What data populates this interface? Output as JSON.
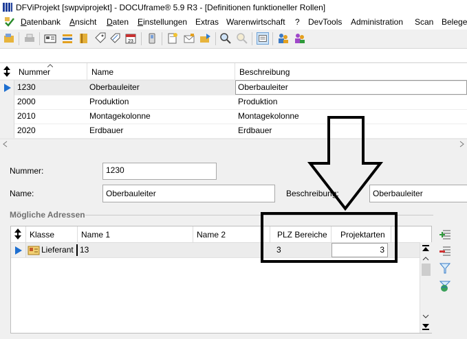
{
  "window": {
    "title": "DFViProjekt [swpviprojekt] - DOCUframe® 5.9 R3 - [Definitionen funktioneller Rollen]"
  },
  "menu": {
    "items": [
      {
        "underline": "D",
        "rest": "atenbank"
      },
      {
        "underline": "A",
        "rest": "nsicht"
      },
      {
        "underline": "D",
        "rest": "aten"
      },
      {
        "underline": "E",
        "rest": "instellungen"
      },
      {
        "underline": "",
        "rest": "Extras"
      },
      {
        "underline": "",
        "rest": "Warenwirtschaft"
      },
      {
        "underline": "",
        "rest": "?"
      },
      {
        "underline": "",
        "rest": "DevTools"
      },
      {
        "underline": "",
        "rest": "Administration"
      },
      {
        "underline": "",
        "rest": "Scan"
      },
      {
        "underline": "",
        "rest": "Beleger"
      }
    ]
  },
  "grid_top": {
    "columns": [
      "Nummer",
      "Name",
      "Beschreibung"
    ],
    "rows": [
      {
        "nummer": "1230",
        "name": "Oberbauleiter",
        "beschreibung": "Oberbauleiter"
      },
      {
        "nummer": "2000",
        "name": "Produktion",
        "beschreibung": "Produktion"
      },
      {
        "nummer": "2010",
        "name": "Montagekolonne",
        "beschreibung": "Montagekolonne"
      },
      {
        "nummer": "2020",
        "name": "Erdbauer",
        "beschreibung": "Erdbauer"
      }
    ]
  },
  "form": {
    "nummer_label": "Nummer:",
    "nummer_value": "1230",
    "name_label": "Name:",
    "name_value": "Oberbauleiter",
    "beschreibung_label": "Beschreibung:",
    "beschreibung_value": "Oberbauleiter"
  },
  "addresses": {
    "group_title": "Mögliche Adressen",
    "columns": [
      "Klasse",
      "Name 1",
      "Name 2",
      "PLZ Bereiche",
      "Projektarten"
    ],
    "rows": [
      {
        "klasse": "Lieferant",
        "name1": "13",
        "name2": "",
        "plz": "3",
        "projektarten": "3"
      }
    ]
  },
  "colors": {
    "selection_arrow": "#1e6fd0",
    "form_background": "#f0f0f0",
    "annotation": "#000000"
  }
}
